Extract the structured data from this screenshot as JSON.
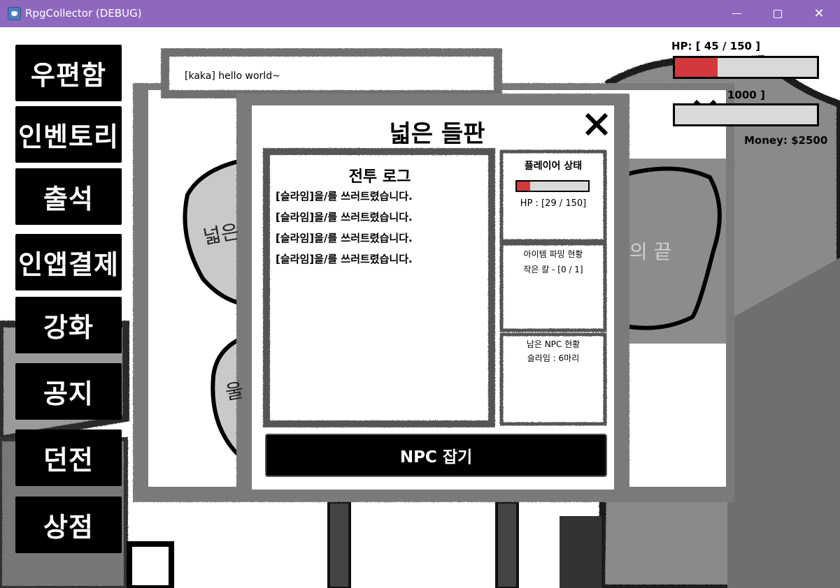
{
  "window": {
    "title": "RpgCollector (DEBUG)",
    "controls": {
      "minimize": "minimize-icon",
      "maximize": "maximize-icon",
      "close": "✕"
    }
  },
  "menu": [
    {
      "id": "mailbox",
      "label": "우편함"
    },
    {
      "id": "inventory",
      "label": "인벤토리"
    },
    {
      "id": "attendance",
      "label": "출석"
    },
    {
      "id": "in-app-purchase",
      "label": "인앱결제"
    },
    {
      "id": "enhance",
      "label": "강화"
    },
    {
      "id": "notice",
      "label": "공지"
    },
    {
      "id": "dungeon",
      "label": "던전"
    },
    {
      "id": "shop",
      "label": "상점"
    }
  ],
  "hud": {
    "hp_label": "HP: [ 45 / 150 ]",
    "hp_fraction": 0.3,
    "second_label_partial": "1000 ]",
    "money": "Money: $2500",
    "colors": {
      "hp_fill": "#d3393c",
      "bar_bg": "#d9d9d9"
    }
  },
  "chat": {
    "line": "[kaka] hello world~"
  },
  "background_labels": {
    "left_blob": "넓은",
    "left_blob_lower": "울",
    "right_blob": "의 끝"
  },
  "dungeon_dialog": {
    "title": "넓은 들판",
    "battle_log": {
      "title": "전투 로그",
      "lines": [
        "[슬라임]을/를 쓰러트렸습니다.",
        "[슬라임]을/를 쓰러트렸습니다.",
        "[슬라임]을/를 쓰러트렸습니다.",
        "[슬라임]을/를 쓰러트렸습니다."
      ]
    },
    "player_status": {
      "title": "플레이어 상태",
      "hp_text": "HP : [29 / 150]",
      "hp_fraction": 0.19
    },
    "item_farming": {
      "title": "아이템 파밍 현황",
      "item": "작은 칼 - [0 / 1]"
    },
    "remaining_npc": {
      "title": "남은 NPC 현황",
      "count": "슬라임 : 6마리"
    },
    "action_button": "NPC 잡기"
  },
  "colors": {
    "titlebar": "#8e67bf",
    "button_bg": "#000000",
    "button_text": "#ffffff",
    "hp": "#d3393c"
  }
}
